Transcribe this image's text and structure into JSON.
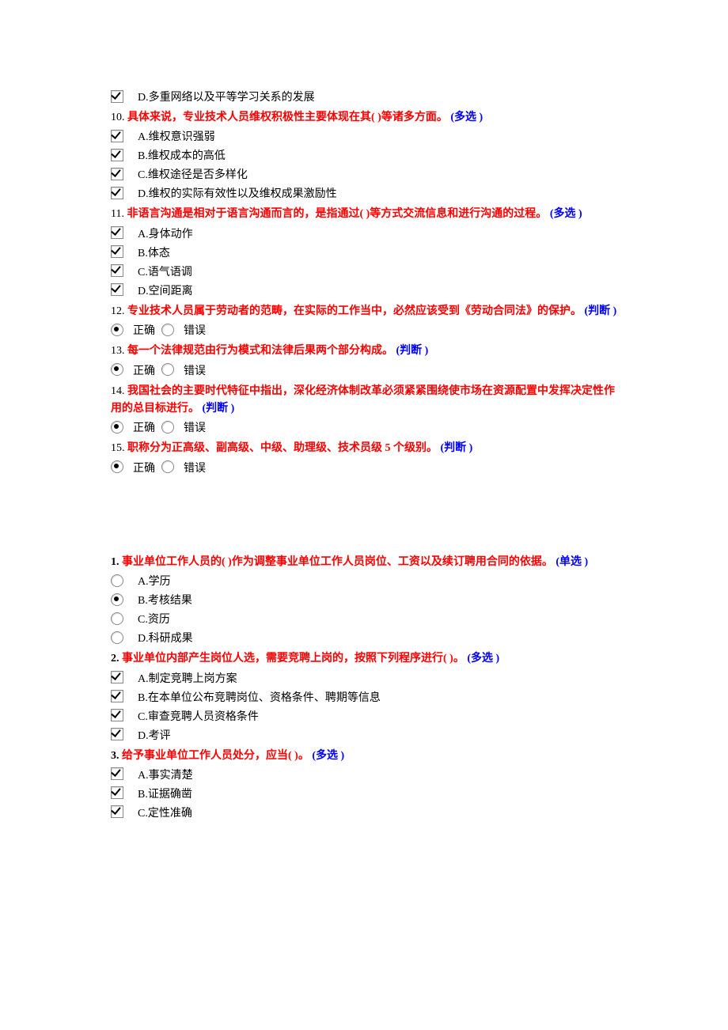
{
  "set1": {
    "q9_dangling_option": {
      "letter": "D.",
      "text": "多重网络以及平等学习关系的发展"
    },
    "q10": {
      "num": "10.",
      "text": "具体来说，专业技术人员维权积极性主要体现在其( )等诸多方面。",
      "type": "(多选 )",
      "options": [
        {
          "letter": "A.",
          "text": "维权意识强弱"
        },
        {
          "letter": "B.",
          "text": "维权成本的高低"
        },
        {
          "letter": "C.",
          "text": "维权途径是否多样化"
        },
        {
          "letter": "D.",
          "text": "维权的实际有效性以及维权成果激励性"
        }
      ]
    },
    "q11": {
      "num": "11.",
      "text": "非语言沟通是相对于语言沟通而言的，是指通过( )等方式交流信息和进行沟通的过程。",
      "type": "(多选 )",
      "options": [
        {
          "letter": "A.",
          "text": "身体动作"
        },
        {
          "letter": "B.",
          "text": "体态"
        },
        {
          "letter": "C.",
          "text": "语气语调"
        },
        {
          "letter": "D.",
          "text": "空间距离"
        }
      ]
    },
    "q12": {
      "num": "12.",
      "text": "专业技术人员属于劳动者的范畴，在实际的工作当中，必然应该受到《劳动合同法》的保护。",
      "type": "(判断 )",
      "tf": {
        "true": "正确",
        "false": "错误"
      }
    },
    "q13": {
      "num": "13.",
      "text": "每一个法律规范由行为模式和法律后果两个部分构成。",
      "type": "(判断 )",
      "tf": {
        "true": "正确",
        "false": "错误"
      }
    },
    "q14": {
      "num": "14.",
      "text": "我国社会的主要时代特征中指出，深化经济体制改革必须紧紧围绕使市场在资源配置中发挥决定性作用的总目标进行。",
      "type": "(判断 )",
      "tf": {
        "true": "正确",
        "false": "错误"
      }
    },
    "q15": {
      "num": "15.",
      "text": "职称分为正高级、副高级、中级、助理级、技术员级 5 个级别。",
      "type": "(判断 )",
      "tf": {
        "true": "正确",
        "false": "错误"
      }
    }
  },
  "set2": {
    "q1": {
      "num": "1.",
      "text": "事业单位工作人员的( )作为调整事业单位工作人员岗位、工资以及续订聘用合同的依据。",
      "type": "(单选 )",
      "options": [
        {
          "letter": "A.",
          "text": "学历"
        },
        {
          "letter": "B.",
          "text": "考核结果"
        },
        {
          "letter": "C.",
          "text": "资历"
        },
        {
          "letter": "D.",
          "text": "科研成果"
        }
      ]
    },
    "q2": {
      "num": "2.",
      "text": "事业单位内部产生岗位人选，需要竞聘上岗的，按照下列程序进行( )。",
      "type": "(多选 )",
      "options": [
        {
          "letter": "A.",
          "text": "制定竞聘上岗方案"
        },
        {
          "letter": "B.",
          "text": "在本单位公布竞聘岗位、资格条件、聘期等信息"
        },
        {
          "letter": "C.",
          "text": "审查竞聘人员资格条件"
        },
        {
          "letter": "D.",
          "text": "考评"
        }
      ]
    },
    "q3": {
      "num": "3.",
      "text": "给予事业单位工作人员处分，应当( )。",
      "type": "(多选 )",
      "options": [
        {
          "letter": "A.",
          "text": "事实清楚"
        },
        {
          "letter": "B.",
          "text": "证据确凿"
        },
        {
          "letter": "C.",
          "text": "定性准确"
        }
      ]
    }
  }
}
